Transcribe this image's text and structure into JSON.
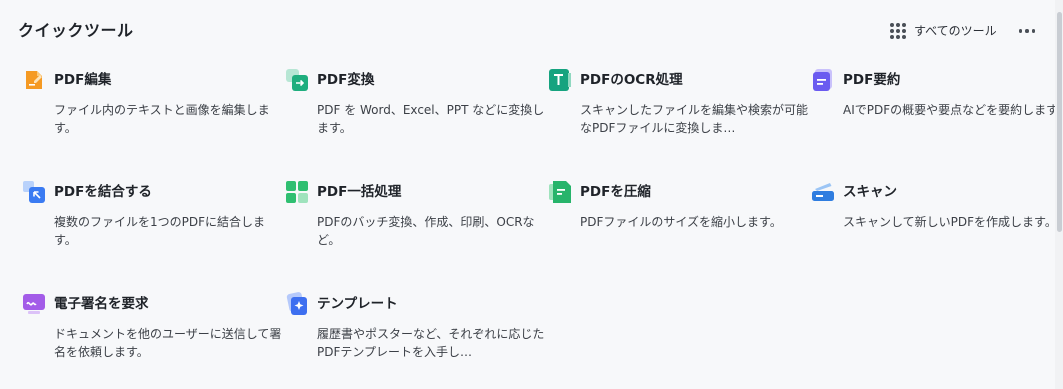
{
  "header": {
    "title": "クイックツール",
    "all_tools_label": "すべてのツール"
  },
  "tools": [
    {
      "name": "PDF編集",
      "desc": "ファイル内のテキストと画像を編集します。",
      "icon": "pdf-edit-icon",
      "color": "#f59a23"
    },
    {
      "name": "PDF変換",
      "desc": "PDF を Word、Excel、PPT などに変換します。",
      "icon": "pdf-convert-icon",
      "color": "#1fae7e"
    },
    {
      "name": "PDFのOCR処理",
      "desc": "スキャンしたファイルを編集や検索が可能なPDFファイルに変換しま…",
      "icon": "ocr-icon",
      "color": "#16a37f"
    },
    {
      "name": "PDF要約",
      "desc": "AIでPDFの概要や要点などを要約します。",
      "icon": "summary-icon",
      "color": "#6b5bf0"
    },
    {
      "name": "PDFを結合する",
      "desc": "複数のファイルを1つのPDFに結合します。",
      "icon": "merge-icon",
      "color": "#3a7bf2"
    },
    {
      "name": "PDF一括処理",
      "desc": "PDFのバッチ変換、作成、印刷、OCRなど。",
      "icon": "batch-icon",
      "color": "#2fbf71"
    },
    {
      "name": "PDFを圧縮",
      "desc": "PDFファイルのサイズを縮小します。",
      "icon": "compress-icon",
      "color": "#27b46b"
    },
    {
      "name": "スキャン",
      "desc": "スキャンして新しいPDFを作成します。",
      "icon": "scan-icon",
      "color": "#2f7de0"
    },
    {
      "name": "電子署名を要求",
      "desc": "ドキュメントを他のユーザーに送信して署名を依頼します。",
      "icon": "esign-icon",
      "color": "#a35ce8"
    },
    {
      "name": "テンプレート",
      "desc": "履歴書やポスターなど、それぞれに応じたPDFテンプレートを入手し…",
      "icon": "template-icon",
      "color": "#3d6ff0"
    }
  ]
}
